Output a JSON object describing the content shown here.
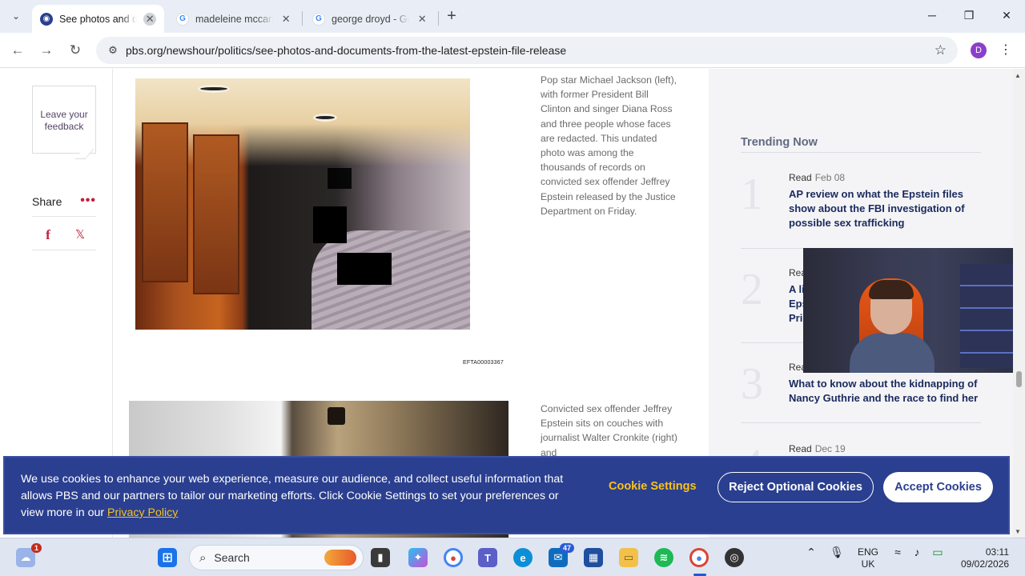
{
  "browser": {
    "tabs": [
      {
        "title": "See photos and documents from the latest Epstein file release",
        "active": true,
        "favicon": "pbs"
      },
      {
        "title": "madeleine mccann",
        "active": false,
        "favicon": "google"
      },
      {
        "title": "george droyd - Google Search",
        "active": false,
        "favicon": "google"
      }
    ],
    "new_tab": "+",
    "url": "pbs.org/newshour/politics/see-photos-and-documents-from-the-latest-epstein-file-release",
    "profile_initial": "D"
  },
  "left_rail": {
    "feedback": "Leave your feedback",
    "share_label": "Share",
    "share_more": "•••",
    "facebook_icon": "f",
    "x_icon": "𝕏"
  },
  "article": {
    "photo1_code": "EFTA00003367",
    "caption1": "Pop star Michael Jackson (left), with former President Bill Clinton and singer Diana Ross and three people whose faces are redacted. This undated photo was among the thousands of records on convicted sex offender Jeffrey Epstein released by the Justice Department on Friday.",
    "caption2": "Convicted sex offender Jeffrey Epstein sits on couches with journalist Walter Cronkite (right) and"
  },
  "trending": {
    "title": "Trending Now",
    "items": [
      {
        "num": "1",
        "label": "Read",
        "date": "Feb 08",
        "headline": "AP review on what the Epstein files show about the FBI investigation of possible sex trafficking"
      },
      {
        "num": "2",
        "label": "Rea",
        "date": "",
        "headline": "A li Eps Pri"
      },
      {
        "num": "3",
        "label": "Rea",
        "date": "",
        "headline": "What to know about the kidnapping of Nancy Guthrie and the race to find her"
      },
      {
        "num": "4",
        "label": "Read",
        "date": "Dec 19",
        "headline": ""
      }
    ]
  },
  "cookie": {
    "text": "We use cookies to enhance your web experience, measure our audience, and collect useful information that allows PBS and our partners to tailor our marketing efforts. Click Cookie Settings to set your preferences or view more in our ",
    "privacy_link": "Privacy Policy",
    "settings": "Cookie Settings",
    "reject": "Reject Optional Cookies",
    "accept": "Accept Cookies"
  },
  "taskbar": {
    "search_placeholder": "Search",
    "weather_badge": "1",
    "mail_badge": "47",
    "lang_top": "ENG",
    "lang_bottom": "UK",
    "time": "03:11",
    "date": "09/02/2026"
  },
  "colors": {
    "pbs_blue": "#2a3f8f",
    "cookie_yellow": "#f8c21c",
    "share_red": "#c41e3a",
    "headline_navy": "#1a2a5e"
  }
}
